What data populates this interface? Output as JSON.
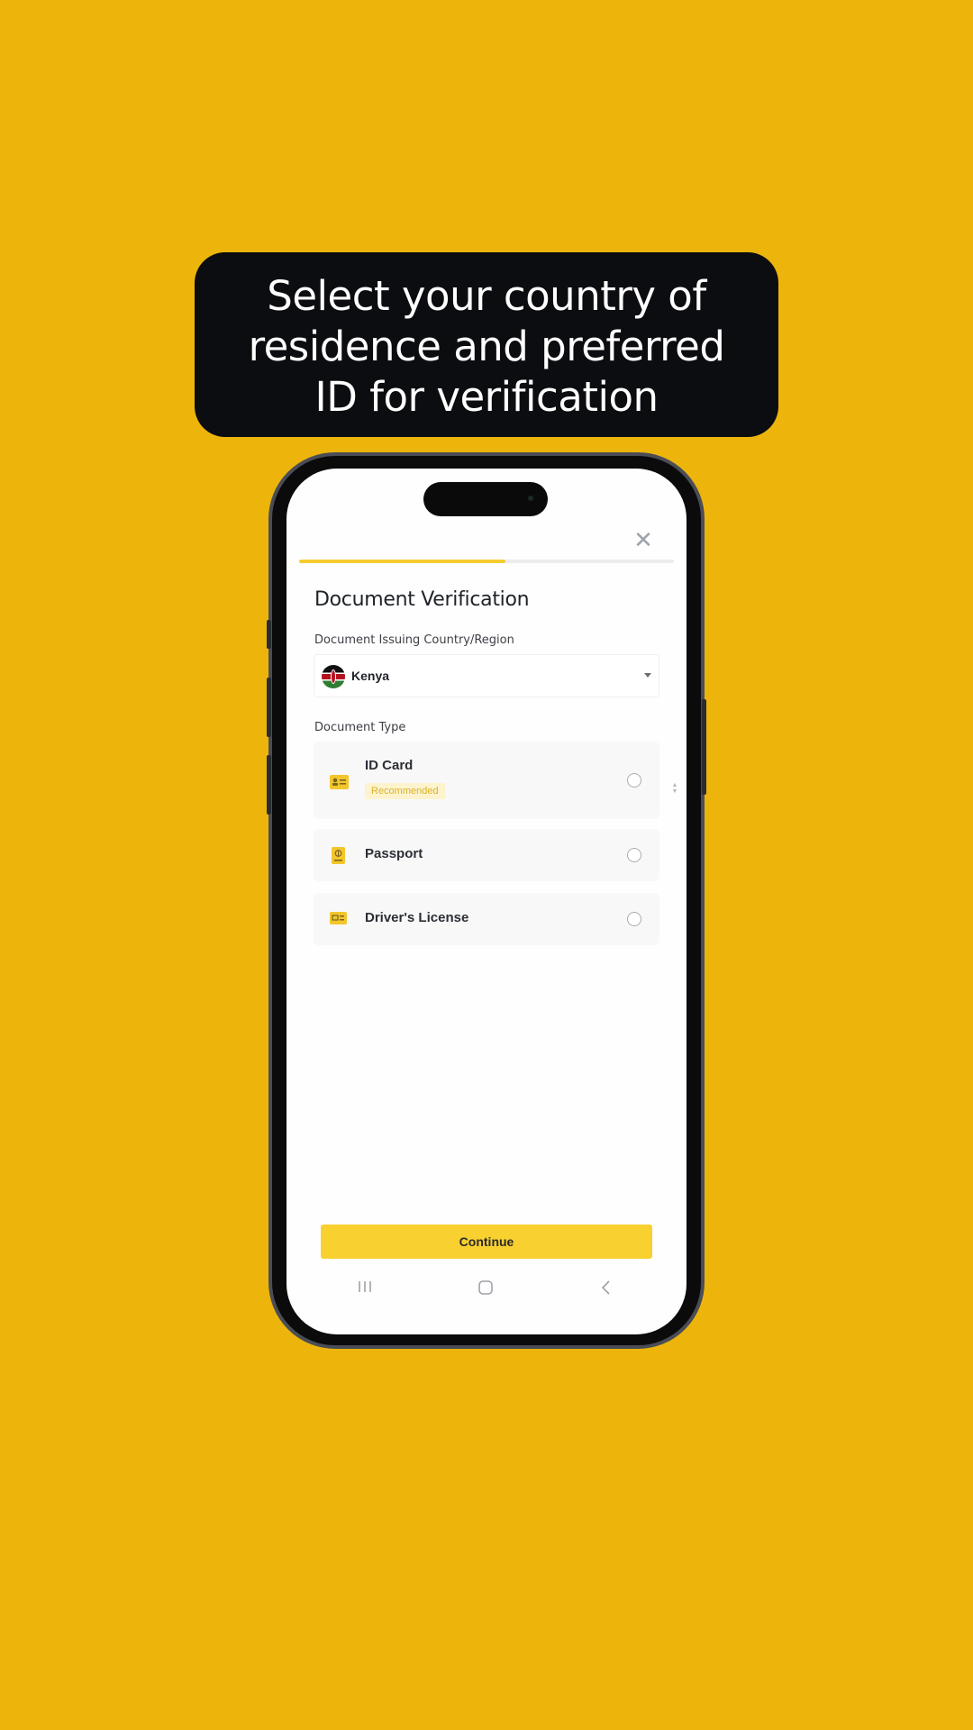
{
  "caption": {
    "lines": [
      "Select your country of",
      "residence and preferred",
      "ID for verification"
    ]
  },
  "app": {
    "close_icon": "close-icon",
    "progress_percent": 55,
    "title": "Document Verification",
    "country_label": "Document Issuing Country/Region",
    "country_value": "Kenya",
    "country_flag": "kenya-flag-icon",
    "doc_type_label": "Document Type",
    "doc_options": [
      {
        "label": "ID Card",
        "badge": "Recommended",
        "icon": "id-card-icon",
        "selected": false
      },
      {
        "label": "Passport",
        "icon": "passport-icon",
        "selected": false
      },
      {
        "label": "Driver's License",
        "icon": "drivers-license-icon",
        "selected": false
      }
    ],
    "continue_label": "Continue"
  },
  "navbar": {
    "recents_icon": "|||",
    "home_icon": "home-icon",
    "back_icon": "back-icon"
  },
  "colors": {
    "background": "#EDB50B",
    "accent": "#F8D030",
    "badge_text": "#D9B22E",
    "badge_bg": "#FDF3CD"
  }
}
